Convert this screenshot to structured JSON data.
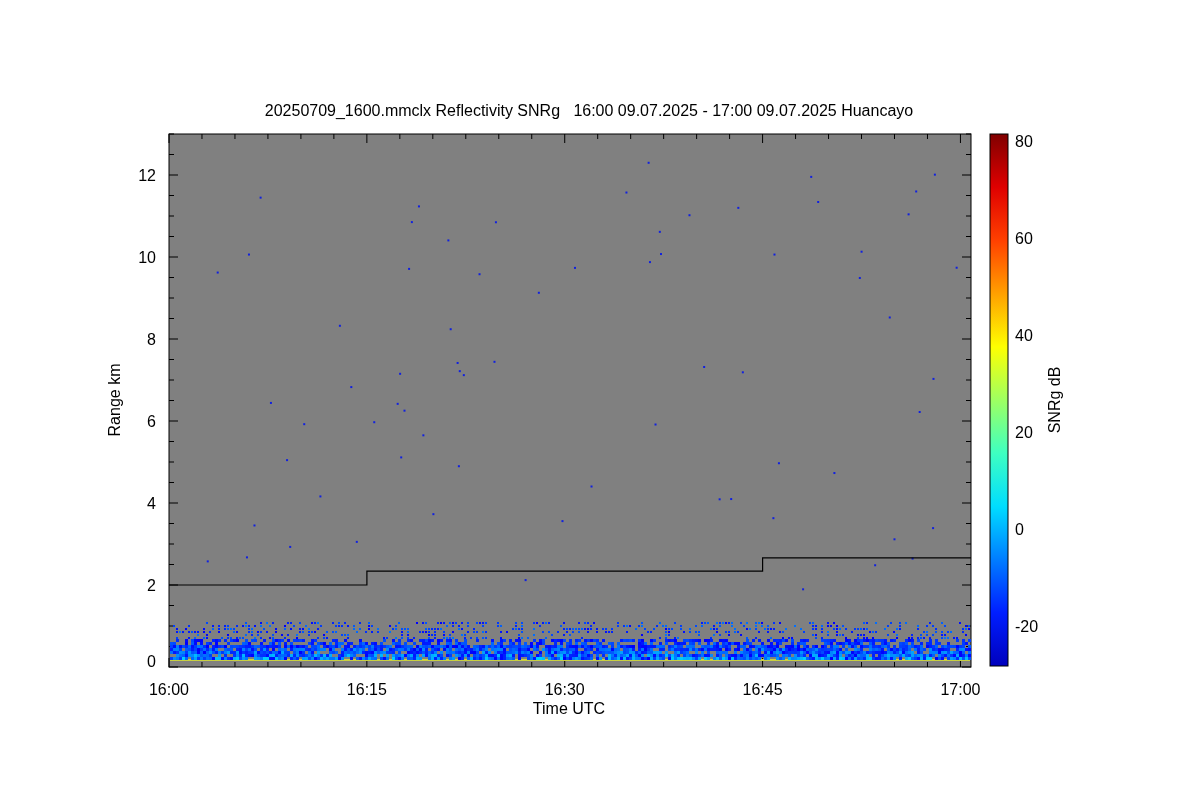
{
  "plot": {
    "title": "20250709_1600.mmclx Reflectivity SNRg   16:00 09.07.2025 - 17:00 09.07.2025 Huancayo",
    "y_axis_label": "Range km",
    "y_tick_labels": [
      "12",
      "10",
      "8",
      "6",
      "4",
      "2",
      "0"
    ],
    "x_tick_labels": [
      "16:00",
      "16:15",
      "16:30",
      "16:45",
      "17:00"
    ],
    "x_axis_label": "Time UTC",
    "colorbar": {
      "label": "SNRg dB",
      "ticks": [
        "80",
        "60",
        "40",
        "20",
        "0",
        "-20"
      ]
    }
  }
}
